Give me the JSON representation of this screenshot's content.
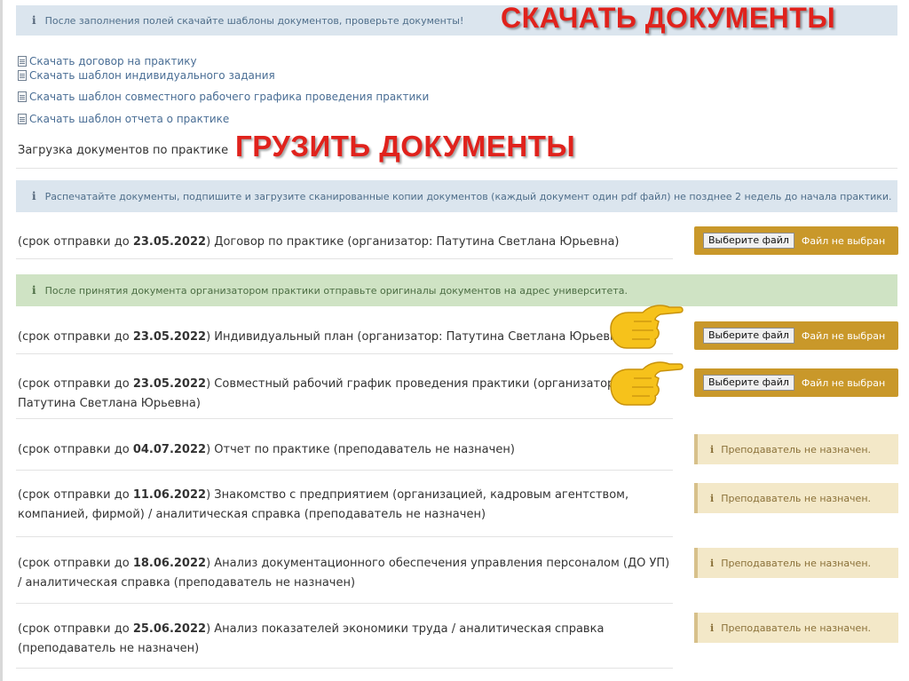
{
  "top_info": {
    "icon": "info-icon",
    "text": "После заполнения полей скачайте шаблоны документов, проверьте документы!"
  },
  "overlay_download": "СКАЧАТЬ ДОКУМЕНТЫ",
  "overlay_upload": "ГРУЗИТЬ ДОКУМЕНТЫ",
  "downloads": [
    "Скачать договор на практику",
    "Скачать шаблон индивидуального задания",
    "Скачать шаблон совместного рабочего графика проведения практики",
    "Скачать шаблон отчета о практике"
  ],
  "upload_section_title": "Загрузка документов по практике",
  "print_info": "Распечатайте документы, подпишите и загрузите сканированные копии документов (каждый документ один pdf файл) не позднее 2 недель до начала практики.",
  "originals_info": "После принятия документа организатором практики отправьте оригиналы документов на адрес университета.",
  "file_button_label": "Выберите файл",
  "file_status": "Файл не выбран",
  "teacher_notice": "Преподаватель не назначен.",
  "rows": [
    {
      "prefix": "(срок отправки до ",
      "date": "23.05.2022",
      "suffix": ") Договор по практике (организатор: Патутина Светлана Юрьевна)"
    },
    {
      "prefix": "(срок отправки до ",
      "date": "23.05.2022",
      "suffix": ") Индивидуальный план (организатор: Патутина Светлана Юрьевна)"
    },
    {
      "prefix": "(срок отправки до ",
      "date": "23.05.2022",
      "suffix": ") Совместный рабочий график проведения практики (организатор: Патутина Светлана Юрьевна)"
    },
    {
      "prefix": "(срок отправки до ",
      "date": "04.07.2022",
      "suffix": ") Отчет по практике (преподаватель не назначен)"
    },
    {
      "prefix": "(срок отправки до ",
      "date": "11.06.2022",
      "suffix": ") Знакомство с предприятием (организацией, кадровым агентством, компанией, фирмой) / аналитическая справка (преподаватель не назначен)"
    },
    {
      "prefix": "(срок отправки до ",
      "date": "18.06.2022",
      "suffix": ") Анализ документационного обеспечения управления персоналом (ДО УП) / аналитическая справка (преподаватель не назначен)"
    },
    {
      "prefix": "(срок отправки до ",
      "date": "25.06.2022",
      "suffix": ") Анализ показателей экономики труда / аналитическая справка (преподаватель не назначен)"
    }
  ],
  "colors": {
    "upload_box": "#c9982a",
    "notice_box": "#f3e8c8",
    "overlay_text": "#e0221c",
    "info_bg": "#dbe5ee",
    "success_bg": "#cfe3c4"
  }
}
